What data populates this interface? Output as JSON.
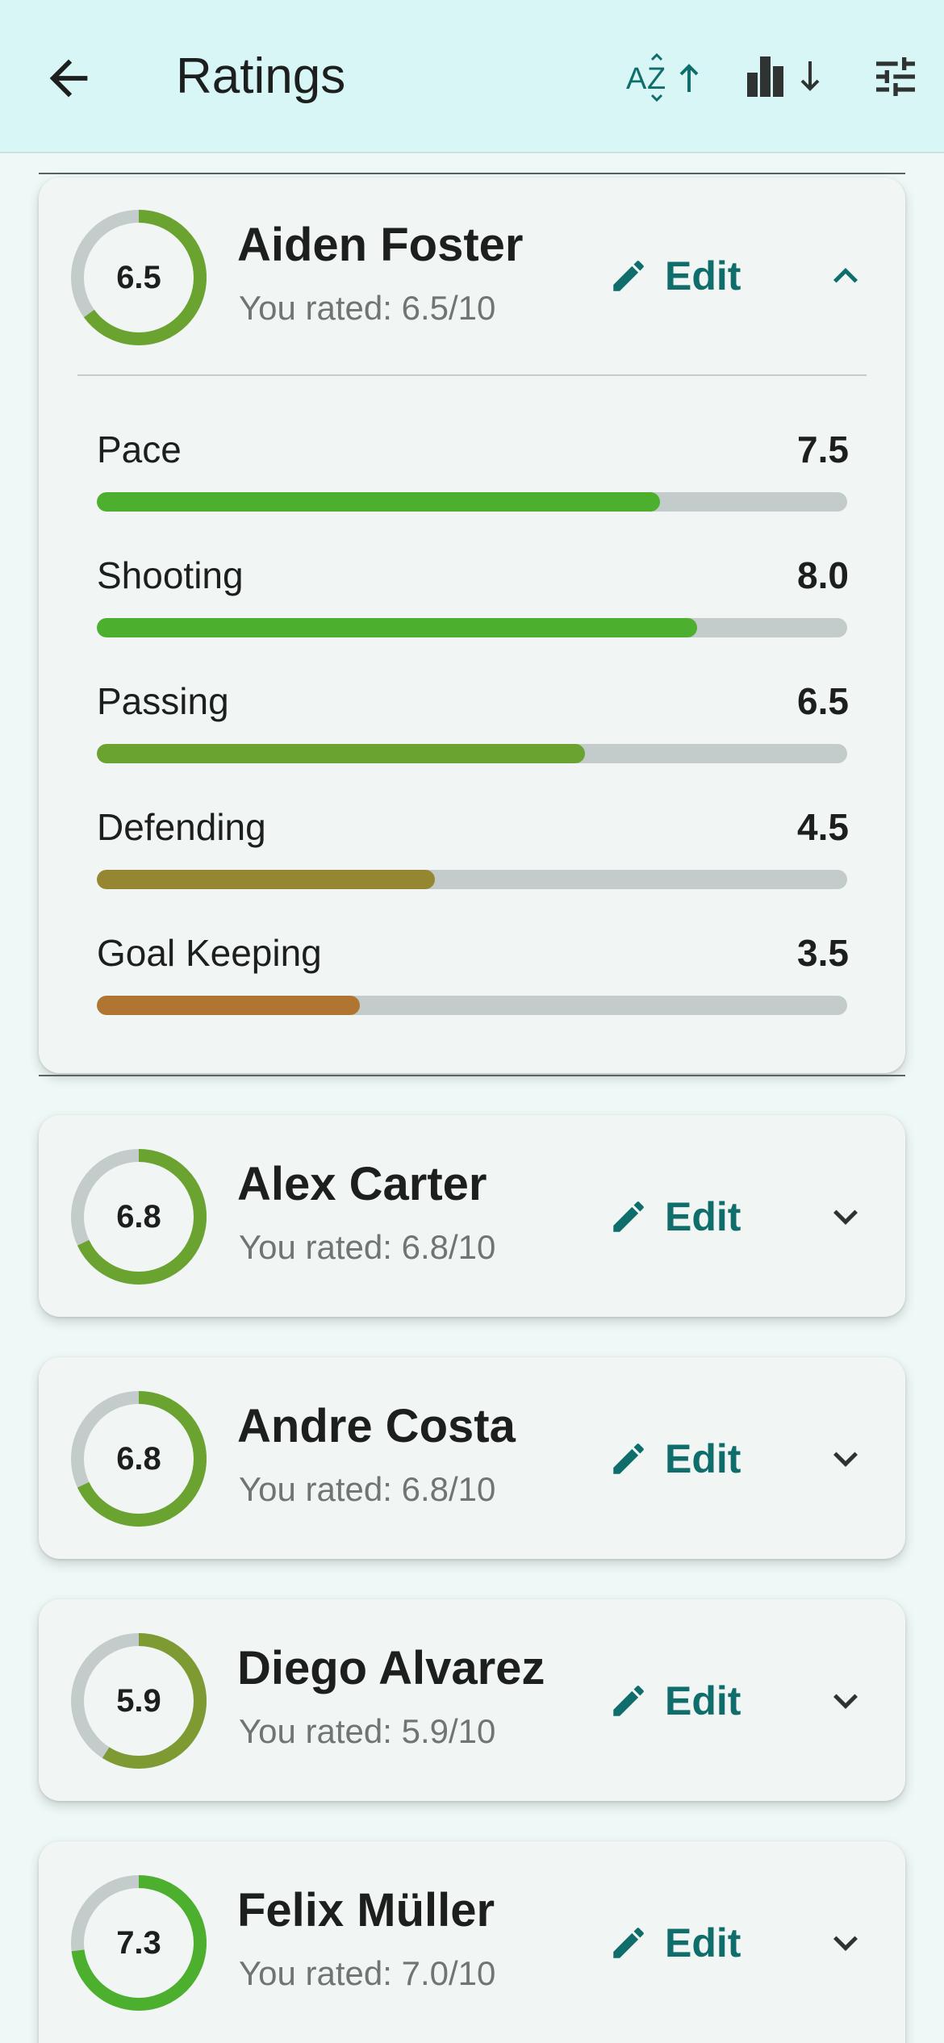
{
  "appbar": {
    "title": "Ratings",
    "icons": [
      "back-arrow-icon",
      "sort-az-icon",
      "sort-rating-icon",
      "filter-tune-icon"
    ]
  },
  "colors": {
    "accent": "#0f6e6b",
    "ring_track": "#c3ccca",
    "green_high": "#4caf2e",
    "green_mid": "#6aa32f",
    "olive": "#7e9a32",
    "mustard": "#958632",
    "orange": "#b07631"
  },
  "players": [
    {
      "name": "Aiden Foster",
      "score": "6.5",
      "score_value": 6.5,
      "you_rated": "You rated: 6.5/10",
      "edit_label": "Edit",
      "expanded": true,
      "stats": [
        {
          "label": "Pace",
          "value": "7.5",
          "fraction": 0.75,
          "color": "#4caf2e"
        },
        {
          "label": "Shooting",
          "value": "8.0",
          "fraction": 0.8,
          "color": "#4caf2e"
        },
        {
          "label": "Passing",
          "value": "6.5",
          "fraction": 0.65,
          "color": "#6aa32f"
        },
        {
          "label": "Defending",
          "value": "4.5",
          "fraction": 0.45,
          "color": "#958632"
        },
        {
          "label": "Goal Keeping",
          "value": "3.5",
          "fraction": 0.35,
          "color": "#b07631"
        }
      ]
    },
    {
      "name": "Alex Carter",
      "score": "6.8",
      "score_value": 6.8,
      "you_rated": "You rated: 6.8/10",
      "edit_label": "Edit",
      "expanded": false
    },
    {
      "name": "Andre Costa",
      "score": "6.8",
      "score_value": 6.8,
      "you_rated": "You rated: 6.8/10",
      "edit_label": "Edit",
      "expanded": false
    },
    {
      "name": "Diego Alvarez",
      "score": "5.9",
      "score_value": 5.9,
      "you_rated": "You rated: 5.9/10",
      "edit_label": "Edit",
      "expanded": false
    },
    {
      "name": "Felix Müller",
      "score": "7.3",
      "score_value": 7.3,
      "you_rated": "You rated: 7.0/10",
      "edit_label": "Edit",
      "expanded": false
    }
  ]
}
